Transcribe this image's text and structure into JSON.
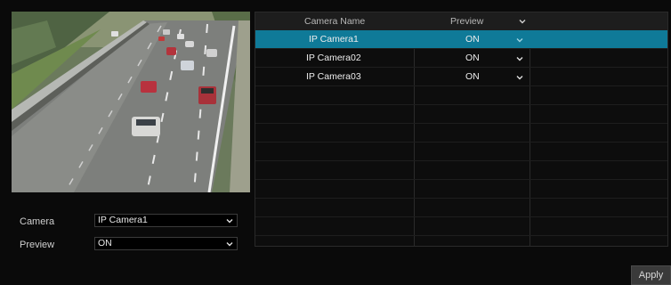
{
  "preview_panel": {
    "alt": "Live camera preview of a highway"
  },
  "form": {
    "camera": {
      "label": "Camera",
      "value": "IP Camera1"
    },
    "preview": {
      "label": "Preview",
      "value": "ON"
    }
  },
  "table": {
    "headers": {
      "camera_name": "Camera Name",
      "preview": "Preview"
    },
    "rows": [
      {
        "camera_name": "IP Camera1",
        "preview": "ON",
        "selected": true
      },
      {
        "camera_name": "IP Camera02",
        "preview": "ON",
        "selected": false
      },
      {
        "camera_name": "IP Camera03",
        "preview": "ON",
        "selected": false
      }
    ]
  },
  "footer": {
    "apply_label": "Apply"
  },
  "colors": {
    "selected_row": "#0f7a98",
    "background": "#0a0a0a"
  }
}
